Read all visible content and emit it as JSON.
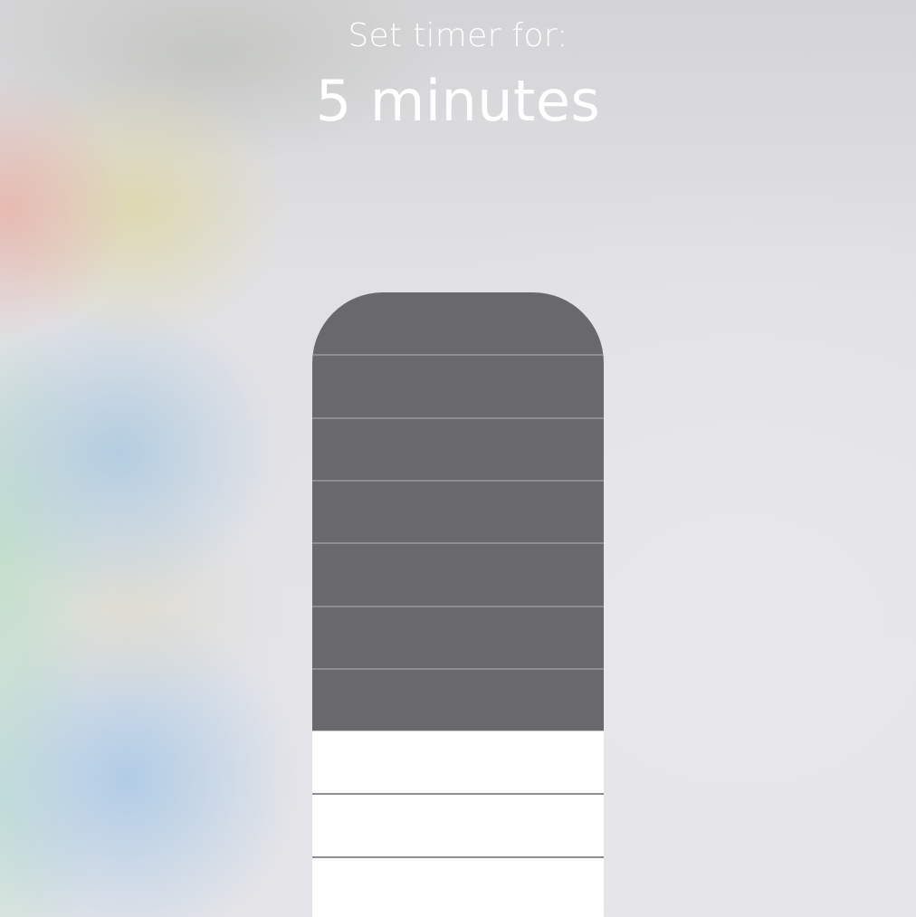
{
  "timer": {
    "prompt": "Set timer for:",
    "value_label": "5 minutes",
    "minutes": 5
  },
  "slider": {
    "filled_segments": 7,
    "total_segments": 10,
    "fill_color": "#69696b",
    "empty_color": "#ffffff"
  }
}
